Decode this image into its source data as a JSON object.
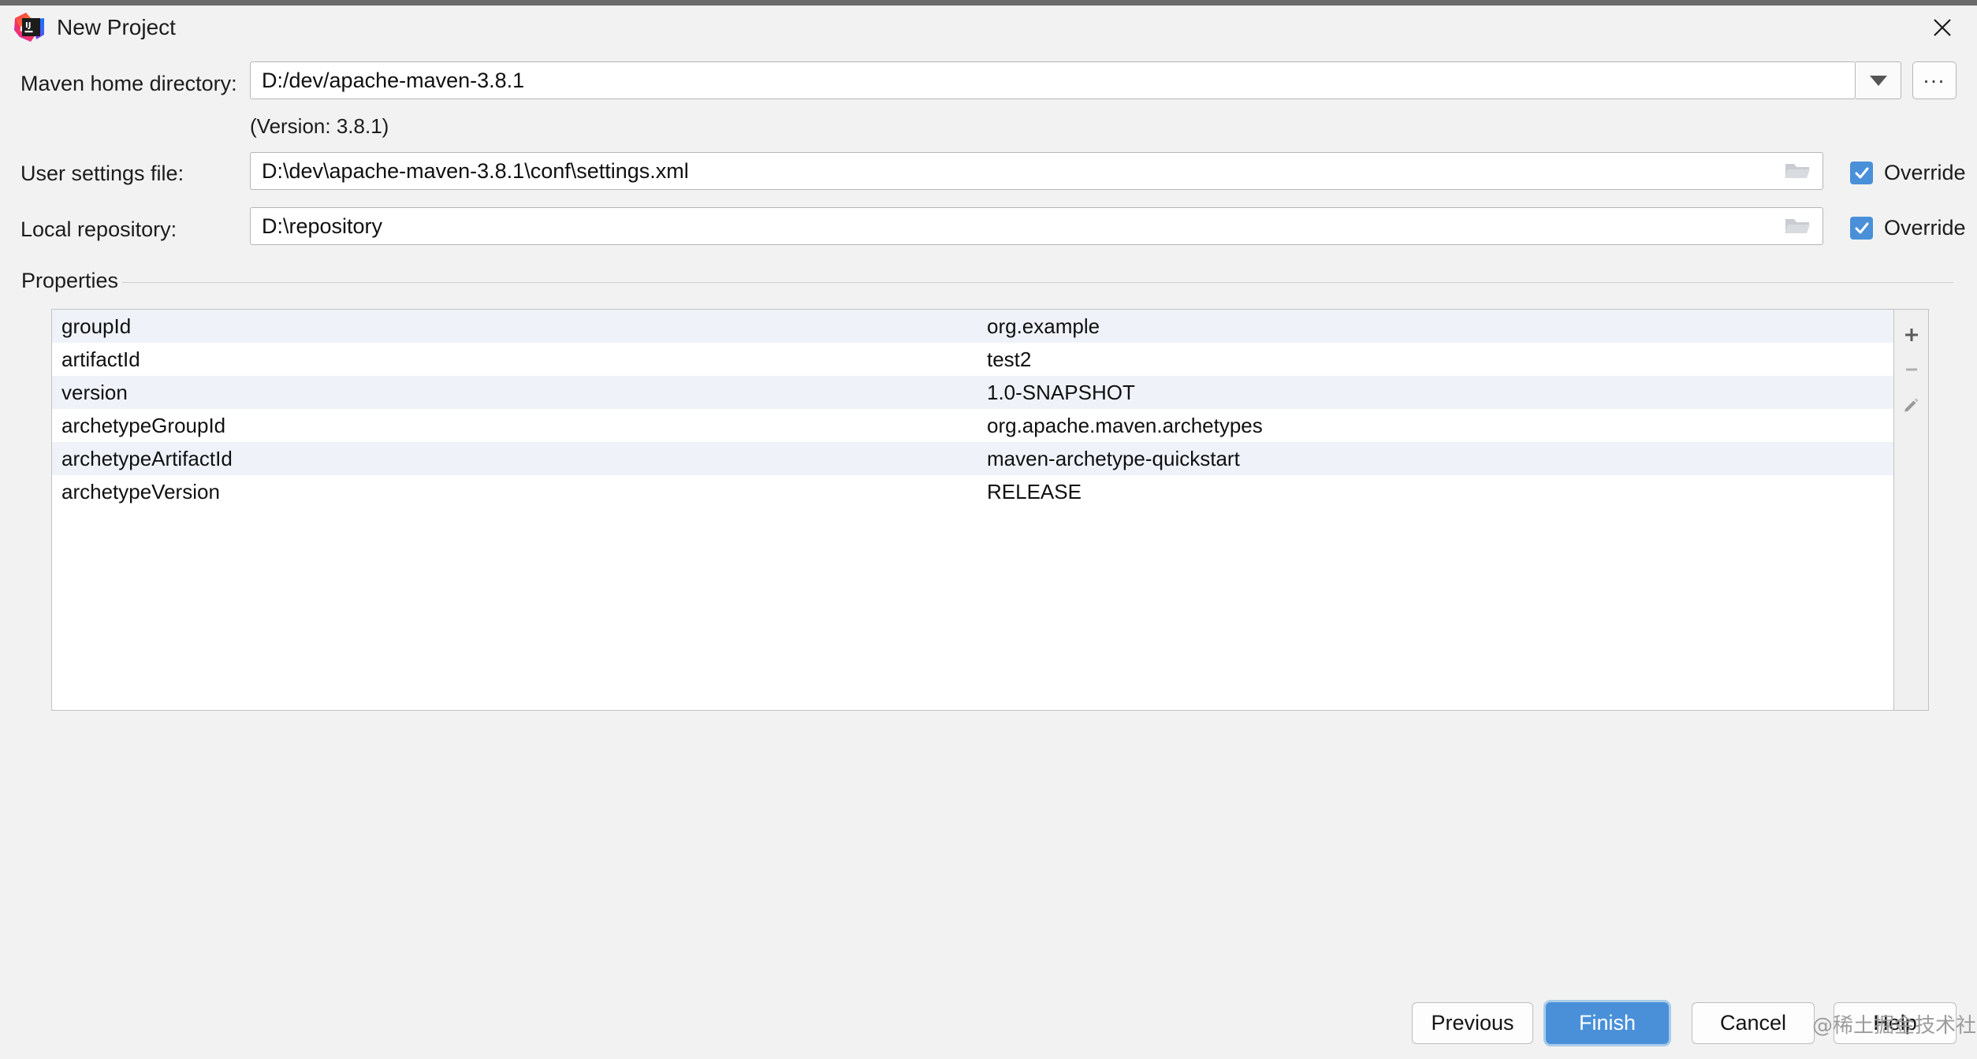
{
  "window": {
    "title": "New Project",
    "logo_icon": "intellij-idea-logo",
    "close_icon": "close-icon"
  },
  "form": {
    "maven_home": {
      "label": "Maven home directory:",
      "value": "D:/dev/apache-maven-3.8.1",
      "dropdown_icon": "chevron-down-icon",
      "browse_label": "...",
      "version_hint": "(Version: 3.8.1)"
    },
    "user_settings": {
      "label": "User settings file:",
      "value": "D:\\dev\\apache-maven-3.8.1\\conf\\settings.xml",
      "folder_icon": "folder-icon",
      "override_label": "Override",
      "override_checked": true
    },
    "local_repository": {
      "label": "Local repository:",
      "value": "D:\\repository",
      "folder_icon": "folder-icon",
      "override_label": "Override",
      "override_checked": true
    }
  },
  "properties": {
    "section_label": "Properties",
    "rows": [
      {
        "key": "groupId",
        "value": "org.example"
      },
      {
        "key": "artifactId",
        "value": "test2"
      },
      {
        "key": "version",
        "value": "1.0-SNAPSHOT"
      },
      {
        "key": "archetypeGroupId",
        "value": "org.apache.maven.archetypes"
      },
      {
        "key": "archetypeArtifactId",
        "value": "maven-archetype-quickstart"
      },
      {
        "key": "archetypeVersion",
        "value": "RELEASE"
      }
    ],
    "toolbar": {
      "add_icon": "plus-icon",
      "remove_icon": "minus-icon",
      "edit_icon": "pencil-icon"
    }
  },
  "footer": {
    "previous_label": "Previous",
    "finish_label": "Finish",
    "cancel_label": "Cancel",
    "help_label": "Help",
    "watermark": "@稀土掘金技术社区"
  },
  "colors": {
    "accent": "#4a90d9",
    "dialog_bg": "#f2f2f2",
    "field_bg": "#ffffff",
    "row_alt": "#eff3f9",
    "border": "#c2c2c2"
  }
}
